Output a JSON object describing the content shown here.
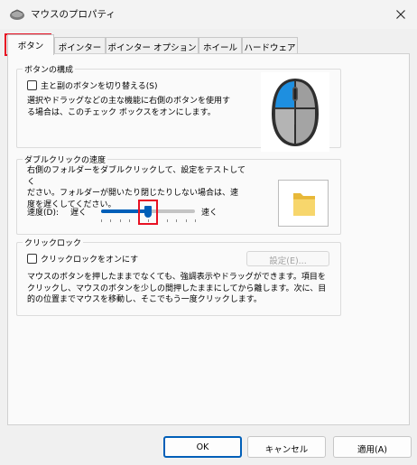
{
  "window": {
    "title": "マウスのプロパティ"
  },
  "tabs": [
    {
      "label": "ボタン",
      "active": true
    },
    {
      "label": "ポインター",
      "active": false
    },
    {
      "label": "ポインター オプション",
      "active": false
    },
    {
      "label": "ホイール",
      "active": false
    },
    {
      "label": "ハードウェア",
      "active": false
    }
  ],
  "button_config": {
    "group_title": "ボタンの構成",
    "checkbox_label": "主と副のボタンを切り替える(S)",
    "checked": false,
    "description": "選択やドラッグなどの主な機能に右側のボタンを使用す\nる場合は、このチェック ボックスをオンにします。"
  },
  "double_click": {
    "group_title": "ダブルクリックの速度",
    "description": "右側のフォルダーをダブルクリックして、設定をテストしてく\nださい。フォルダーが開いたり閉じたりしない場合は、速\n度を遅くしてください。",
    "speed_label": "速度(D):",
    "slow_label": "遅く",
    "fast_label": "速く",
    "speed_fraction": 0.5
  },
  "click_lock": {
    "group_title": "クリックロック",
    "checkbox_label": "クリックロックをオンにす",
    "checked": false,
    "settings_button": "設定(E)...",
    "description": "マウスのボタンを押したままでなくても、強調表示やドラッグができます。項目を\nクリックし、マウスのボタンを少しの間押したままにしてから離します。次に、目\n的の位置までマウスを移動し、そこでもう一度クリックします。"
  },
  "footer": {
    "ok": "OK",
    "cancel": "キャンセル",
    "apply": "適用(A)"
  },
  "colors": {
    "accent": "#005fb8",
    "highlight": "#e81123"
  }
}
